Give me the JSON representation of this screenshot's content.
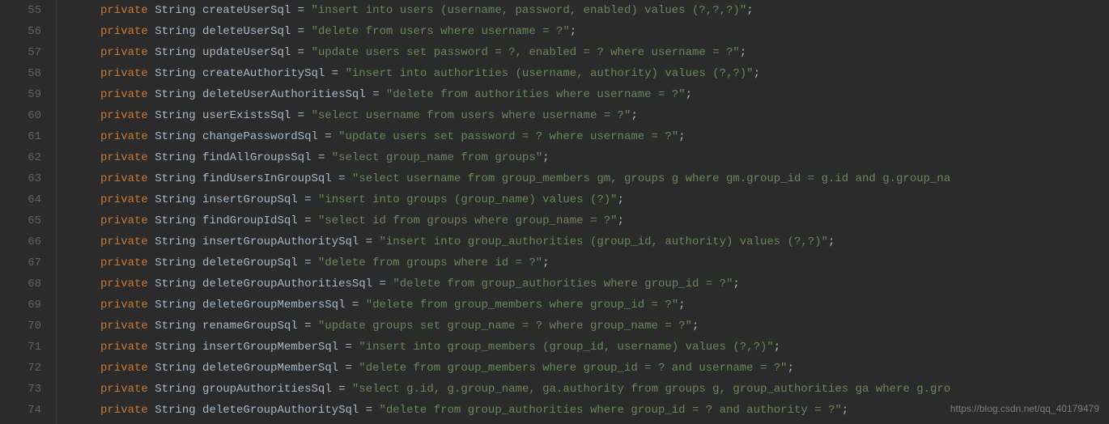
{
  "watermark": "https://blog.csdn.net/qq_40179479",
  "startLine": 55,
  "tokens": {
    "private": "private",
    "String": "String",
    "assign": " = ",
    "semi": ";"
  },
  "lines": [
    {
      "name": "createUserSql",
      "value": "\"insert into users (username, password, enabled) values (?,?,?)\""
    },
    {
      "name": "deleteUserSql",
      "value": "\"delete from users where username = ?\""
    },
    {
      "name": "updateUserSql",
      "value": "\"update users set password = ?, enabled = ? where username = ?\""
    },
    {
      "name": "createAuthoritySql",
      "value": "\"insert into authorities (username, authority) values (?,?)\""
    },
    {
      "name": "deleteUserAuthoritiesSql",
      "value": "\"delete from authorities where username = ?\""
    },
    {
      "name": "userExistsSql",
      "value": "\"select username from users where username = ?\""
    },
    {
      "name": "changePasswordSql",
      "value": "\"update users set password = ? where username = ?\""
    },
    {
      "name": "findAllGroupsSql",
      "value": "\"select group_name from groups\""
    },
    {
      "name": "findUsersInGroupSql",
      "value": "\"select username from group_members gm, groups g where gm.group_id = g.id and g.group_na"
    },
    {
      "name": "insertGroupSql",
      "value": "\"insert into groups (group_name) values (?)\""
    },
    {
      "name": "findGroupIdSql",
      "value": "\"select id from groups where group_name = ?\""
    },
    {
      "name": "insertGroupAuthoritySql",
      "value": "\"insert into group_authorities (group_id, authority) values (?,?)\""
    },
    {
      "name": "deleteGroupSql",
      "value": "\"delete from groups where id = ?\""
    },
    {
      "name": "deleteGroupAuthoritiesSql",
      "value": "\"delete from group_authorities where group_id = ?\""
    },
    {
      "name": "deleteGroupMembersSql",
      "value": "\"delete from group_members where group_id = ?\""
    },
    {
      "name": "renameGroupSql",
      "value": "\"update groups set group_name = ? where group_name = ?\""
    },
    {
      "name": "insertGroupMemberSql",
      "value": "\"insert into group_members (group_id, username) values (?,?)\""
    },
    {
      "name": "deleteGroupMemberSql",
      "value": "\"delete from group_members where group_id = ? and username = ?\""
    },
    {
      "name": "groupAuthoritiesSql",
      "value": "\"select g.id, g.group_name, ga.authority from groups g, group_authorities ga where g.gro"
    },
    {
      "name": "deleteGroupAuthoritySql",
      "value": "\"delete from group_authorities where group_id = ? and authority = ?\""
    }
  ]
}
